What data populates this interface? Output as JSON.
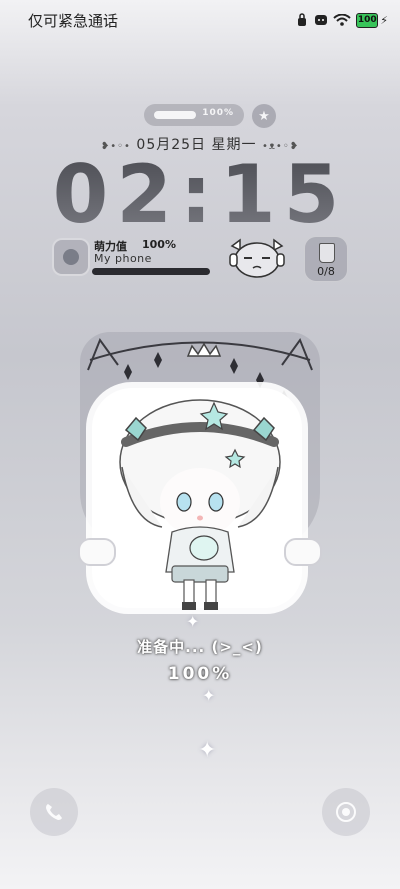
{
  "status_bar": {
    "carrier_text": "仅可紧急通话",
    "battery": "100",
    "icons": [
      "alarm-icon",
      "message-icon",
      "wifi-icon",
      "battery-icon",
      "charging-icon"
    ]
  },
  "top_widget": {
    "pill_text": "100%",
    "round_icon": "star-icon"
  },
  "date": {
    "text": "05月25日 星期一"
  },
  "clock": {
    "time": "02:15"
  },
  "widget": {
    "cute_label": "萌力值",
    "cute_value": "100%",
    "phone_name": "My phone",
    "cup_count": "0/8"
  },
  "loading": {
    "status": "准备中... (>_<)",
    "percent": "100%"
  },
  "bottom": {
    "left_icon": "phone-icon",
    "right_icon": "camera-icon"
  },
  "colors": {
    "background": "#c6c7ce",
    "clock": "#5c5d63",
    "battery_fill": "#38c45a"
  }
}
